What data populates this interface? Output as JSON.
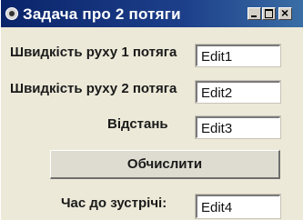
{
  "window": {
    "title": "Задача про 2 потяги"
  },
  "form": {
    "speed1_label": "Швидкість руху 1 потяга",
    "speed1_value": "Edit1",
    "speed2_label": "Швидкість руху 2 потяга",
    "speed2_value": "Edit2",
    "distance_label": "Відстань",
    "distance_value": "Edit3",
    "calculate_label": "Обчислити",
    "time_label": "Час  до зустрічі:",
    "time_value": "Edit4"
  },
  "icons": {
    "app": "app-icon",
    "minimize": "minimize-icon",
    "maximize": "maximize-icon",
    "close": "close-icon"
  },
  "colors": {
    "titlebar": "#0a246a",
    "window_bg": "#ece9d8"
  }
}
